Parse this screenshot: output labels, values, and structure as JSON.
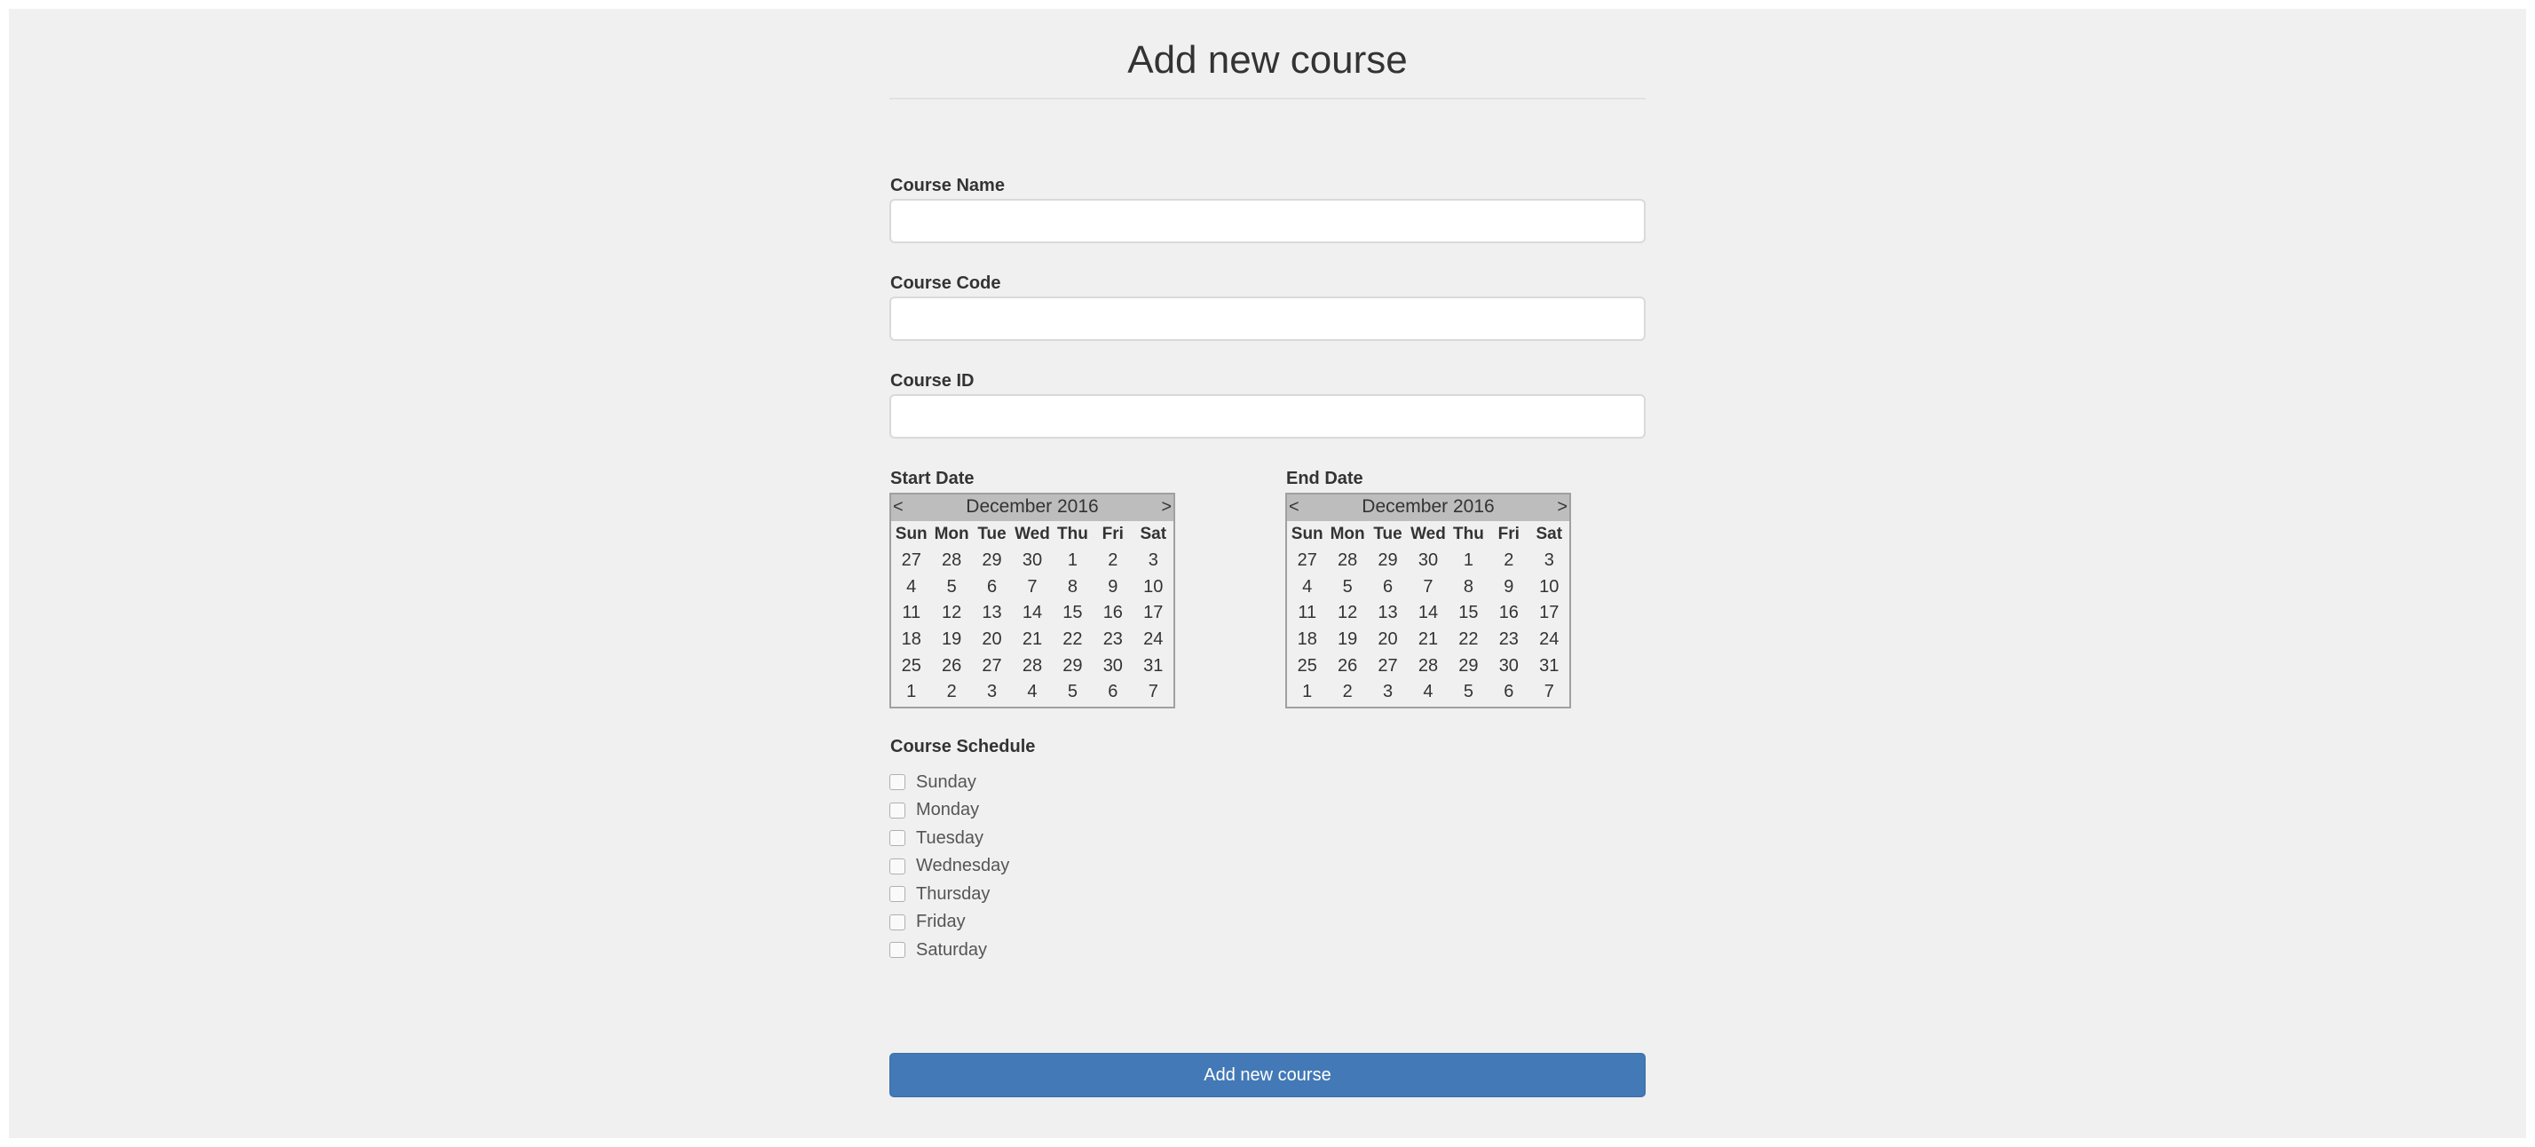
{
  "page": {
    "title": "Add new course"
  },
  "form": {
    "course_name": {
      "label": "Course Name",
      "value": "",
      "placeholder": ""
    },
    "course_code": {
      "label": "Course Code",
      "value": "",
      "placeholder": ""
    },
    "course_id": {
      "label": "Course ID",
      "value": "",
      "placeholder": ""
    },
    "start_date": {
      "label": "Start Date",
      "calendar": {
        "prev": "<",
        "next": ">",
        "month_year": "December 2016",
        "weekdays": [
          "Sun",
          "Mon",
          "Tue",
          "Wed",
          "Thu",
          "Fri",
          "Sat"
        ],
        "weeks": [
          [
            "27",
            "28",
            "29",
            "30",
            "1",
            "2",
            "3"
          ],
          [
            "4",
            "5",
            "6",
            "7",
            "8",
            "9",
            "10"
          ],
          [
            "11",
            "12",
            "13",
            "14",
            "15",
            "16",
            "17"
          ],
          [
            "18",
            "19",
            "20",
            "21",
            "22",
            "23",
            "24"
          ],
          [
            "25",
            "26",
            "27",
            "28",
            "29",
            "30",
            "31"
          ],
          [
            "1",
            "2",
            "3",
            "4",
            "5",
            "6",
            "7"
          ]
        ]
      }
    },
    "end_date": {
      "label": "End Date",
      "calendar": {
        "prev": "<",
        "next": ">",
        "month_year": "December 2016",
        "weekdays": [
          "Sun",
          "Mon",
          "Tue",
          "Wed",
          "Thu",
          "Fri",
          "Sat"
        ],
        "weeks": [
          [
            "27",
            "28",
            "29",
            "30",
            "1",
            "2",
            "3"
          ],
          [
            "4",
            "5",
            "6",
            "7",
            "8",
            "9",
            "10"
          ],
          [
            "11",
            "12",
            "13",
            "14",
            "15",
            "16",
            "17"
          ],
          [
            "18",
            "19",
            "20",
            "21",
            "22",
            "23",
            "24"
          ],
          [
            "25",
            "26",
            "27",
            "28",
            "29",
            "30",
            "31"
          ],
          [
            "1",
            "2",
            "3",
            "4",
            "5",
            "6",
            "7"
          ]
        ]
      }
    },
    "schedule": {
      "label": "Course Schedule",
      "days": [
        {
          "name": "Sunday",
          "checked": false
        },
        {
          "name": "Monday",
          "checked": false
        },
        {
          "name": "Tuesday",
          "checked": false
        },
        {
          "name": "Wednesday",
          "checked": false
        },
        {
          "name": "Thursday",
          "checked": false
        },
        {
          "name": "Friday",
          "checked": false
        },
        {
          "name": "Saturday",
          "checked": false
        }
      ]
    },
    "submit_label": "Add new course"
  },
  "colors": {
    "background": "#f0f0f0",
    "button": "#4279b6",
    "calendar_header": "#bdbdbd"
  }
}
